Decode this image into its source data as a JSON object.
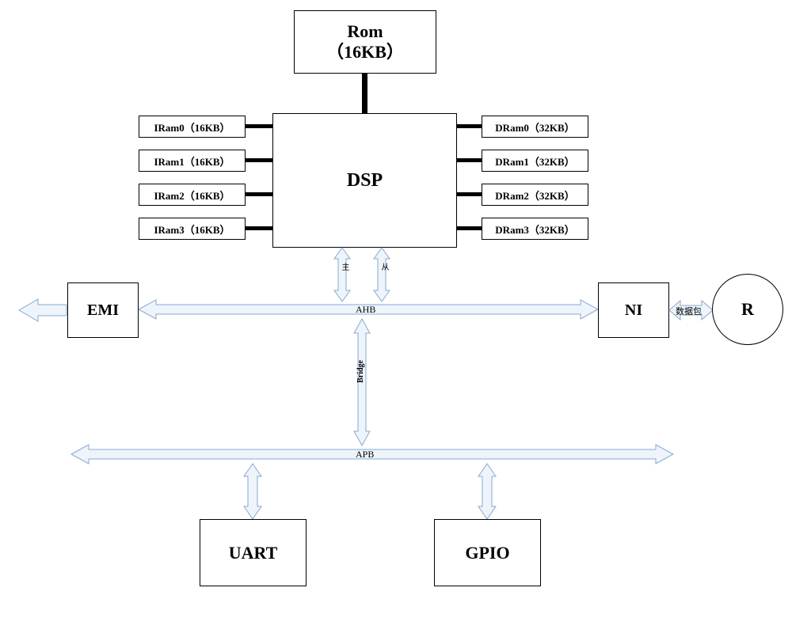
{
  "blocks": {
    "rom_line1": "Rom",
    "rom_line2": "（16KB）",
    "dsp": "DSP",
    "emi": "EMI",
    "ni": "NI",
    "r": "R",
    "uart": "UART",
    "gpio": "GPIO",
    "iram": [
      "IRam0（16KB）",
      "IRam1（16KB）",
      "IRam2（16KB）",
      "IRam3（16KB）"
    ],
    "dram": [
      "DRam0（32KB）",
      "DRam1（32KB）",
      "DRam2（32KB）",
      "DRam3（32KB）"
    ]
  },
  "labels": {
    "ahb": "AHB",
    "apb": "APB",
    "bridge": "Bridge",
    "master": "主",
    "slave": "从",
    "packet": "数据包"
  }
}
